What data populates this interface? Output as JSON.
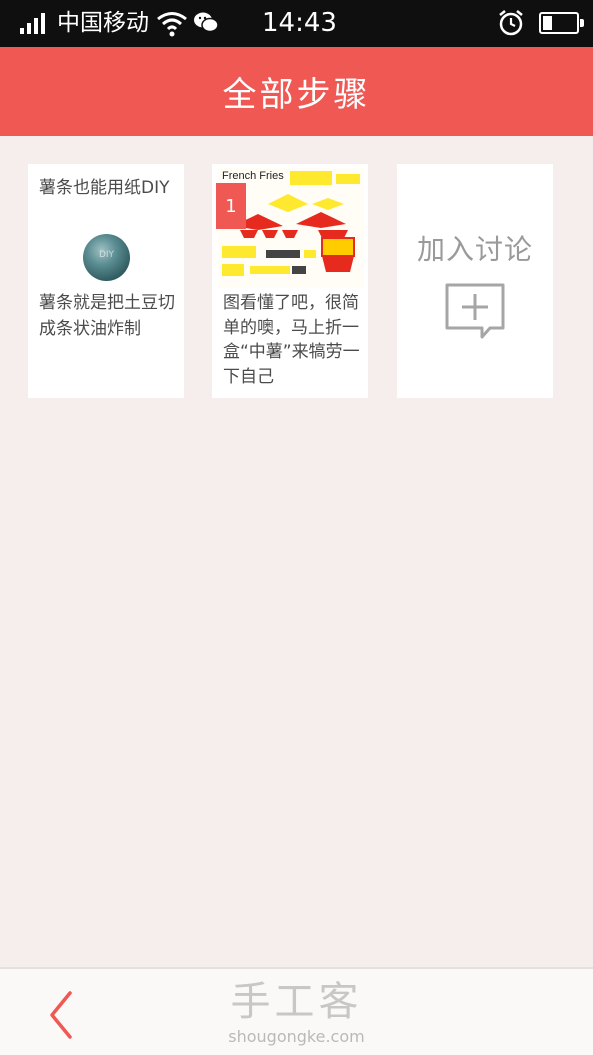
{
  "status_bar": {
    "carrier": "中国移动",
    "time": "14:43"
  },
  "header": {
    "title": "全部步骤"
  },
  "cards": [
    {
      "title": "薯条也能用纸DIY",
      "avatar_text": "DIY",
      "description": "薯条就是把土豆切成条状油炸制"
    },
    {
      "step": "1",
      "thumbnail_caption": "French Fries",
      "description": "图看懂了吧，很简单的噢，马上折一盒“中薯”来犒劳一下自己"
    },
    {
      "label": "加入讨论",
      "icon": "add-comment-icon"
    }
  ],
  "bottom_bar": {
    "logo": "手工客",
    "url": "shougongke.com"
  },
  "colors": {
    "accent": "#ef5853",
    "background": "#f6eeed"
  }
}
